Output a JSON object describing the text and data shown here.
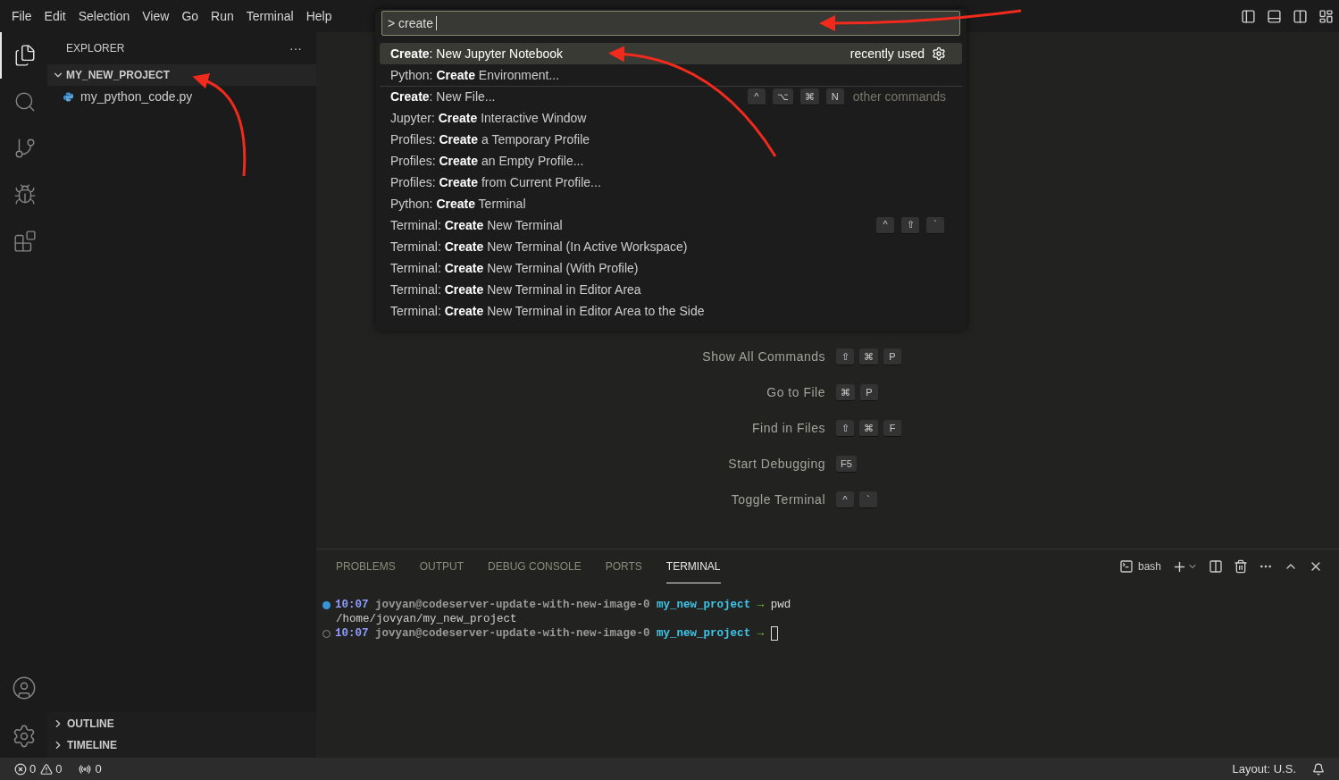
{
  "menu_bar": [
    "File",
    "Edit",
    "Selection",
    "View",
    "Go",
    "Run",
    "Terminal",
    "Help"
  ],
  "activity_bar": [
    {
      "kind": "files",
      "selected": true
    },
    {
      "kind": "search",
      "selected": false
    },
    {
      "kind": "source-control",
      "selected": false
    },
    {
      "kind": "run-debug",
      "selected": false
    },
    {
      "kind": "extensions",
      "selected": false
    }
  ],
  "sidebar": {
    "title": "EXPLORER",
    "more": "···",
    "folder": {
      "name": "MY_NEW_PROJECT",
      "expanded": true,
      "children": [
        {
          "name": "my_python_code.py"
        }
      ]
    },
    "sections": [
      {
        "name": "OUTLINE",
        "expanded": false
      },
      {
        "name": "TIMELINE",
        "expanded": false
      }
    ]
  },
  "command_palette": {
    "value": "> create",
    "items": [
      {
        "label": "**Create**: New Jupyter Notebook",
        "selected": true,
        "separator": false,
        "note": "recently used"
      },
      {
        "label": "Python: **Create** Environment...",
        "selected": false,
        "separator": false
      },
      {
        "label": "**Create**: New File...",
        "selected": false,
        "separator": true,
        "note": "other commands",
        "keys": [
          "^",
          "⌥",
          "⌘",
          "N"
        ]
      },
      {
        "label": "Jupyter: **Create** Interactive Window",
        "selected": false,
        "separator": false
      },
      {
        "label": "Profiles: **Create** a Temporary Profile",
        "selected": false,
        "separator": false
      },
      {
        "label": "Profiles: **Create** an Empty Profile...",
        "selected": false,
        "separator": false
      },
      {
        "label": "Profiles: **Create** from Current Profile...",
        "selected": false,
        "separator": false
      },
      {
        "label": "Python: **Create** Terminal",
        "selected": false,
        "separator": false
      },
      {
        "label": "Terminal: **Create** New Terminal",
        "selected": false,
        "separator": false,
        "keys": [
          "^",
          "⇧",
          "`"
        ]
      },
      {
        "label": "Terminal: **Create** New Terminal (In Active Workspace)",
        "selected": false,
        "separator": false
      },
      {
        "label": "Terminal: **Create** New Terminal (With Profile)",
        "selected": false,
        "separator": false
      },
      {
        "label": "Terminal: **Create** New Terminal in Editor Area",
        "selected": false,
        "separator": false
      },
      {
        "label": "Terminal: **Create** New Terminal in Editor Area to the Side",
        "selected": false,
        "separator": false
      }
    ]
  },
  "shortcuts": [
    {
      "label": "Show All Commands",
      "keys": [
        "⇧",
        "⌘",
        "P"
      ]
    },
    {
      "label": "Go to File",
      "keys": [
        "⌘",
        "P"
      ]
    },
    {
      "label": "Find in Files",
      "keys": [
        "⇧",
        "⌘",
        "F"
      ]
    },
    {
      "label": "Start Debugging",
      "keys": [
        "F5"
      ]
    },
    {
      "label": "Toggle Terminal",
      "keys": [
        "^",
        "`"
      ]
    }
  ],
  "panel": {
    "tabs": [
      {
        "label": "PROBLEMS",
        "selected": false
      },
      {
        "label": "OUTPUT",
        "selected": false
      },
      {
        "label": "DEBUG CONSOLE",
        "selected": false
      },
      {
        "label": "PORTS",
        "selected": false
      },
      {
        "label": "TERMINAL",
        "selected": true
      }
    ],
    "shell": "bash",
    "terminal": [
      {
        "kind": "prompt",
        "completed": true,
        "time": "10:07",
        "host": "jovyan@codeserver-update-with-new-image-0",
        "dir": "my_new_project",
        "arrow": "→",
        "command": "pwd"
      },
      {
        "kind": "output",
        "text": "/home/jovyan/my_new_project"
      },
      {
        "kind": "prompt",
        "completed": false,
        "cursor": true,
        "time": "10:07",
        "host": "jovyan@codeserver-update-with-new-image-0",
        "dir": "my_new_project",
        "arrow": "→"
      }
    ]
  },
  "status_bar": {
    "errors": "0",
    "warnings": "0",
    "ports": "0",
    "layout": "Layout: U.S."
  }
}
